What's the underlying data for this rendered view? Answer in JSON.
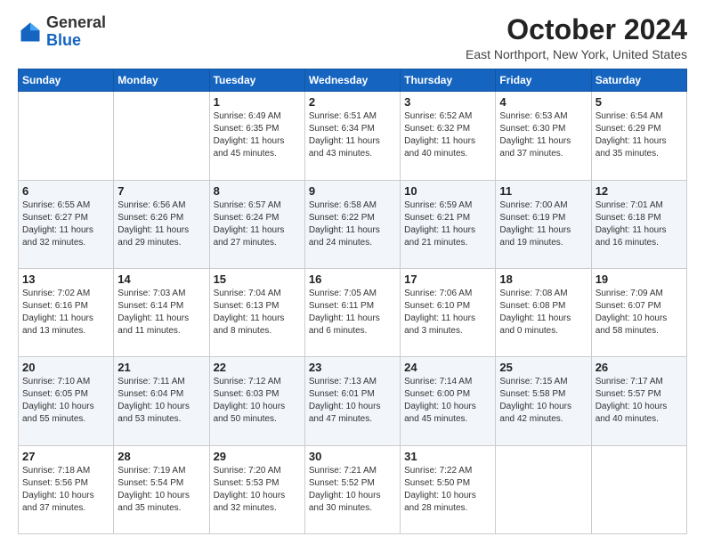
{
  "header": {
    "logo_general": "General",
    "logo_blue": "Blue",
    "month_title": "October 2024",
    "location": "East Northport, New York, United States"
  },
  "days_of_week": [
    "Sunday",
    "Monday",
    "Tuesday",
    "Wednesday",
    "Thursday",
    "Friday",
    "Saturday"
  ],
  "weeks": [
    [
      {
        "day": "",
        "info": ""
      },
      {
        "day": "",
        "info": ""
      },
      {
        "day": "1",
        "info": "Sunrise: 6:49 AM\nSunset: 6:35 PM\nDaylight: 11 hours and 45 minutes."
      },
      {
        "day": "2",
        "info": "Sunrise: 6:51 AM\nSunset: 6:34 PM\nDaylight: 11 hours and 43 minutes."
      },
      {
        "day": "3",
        "info": "Sunrise: 6:52 AM\nSunset: 6:32 PM\nDaylight: 11 hours and 40 minutes."
      },
      {
        "day": "4",
        "info": "Sunrise: 6:53 AM\nSunset: 6:30 PM\nDaylight: 11 hours and 37 minutes."
      },
      {
        "day": "5",
        "info": "Sunrise: 6:54 AM\nSunset: 6:29 PM\nDaylight: 11 hours and 35 minutes."
      }
    ],
    [
      {
        "day": "6",
        "info": "Sunrise: 6:55 AM\nSunset: 6:27 PM\nDaylight: 11 hours and 32 minutes."
      },
      {
        "day": "7",
        "info": "Sunrise: 6:56 AM\nSunset: 6:26 PM\nDaylight: 11 hours and 29 minutes."
      },
      {
        "day": "8",
        "info": "Sunrise: 6:57 AM\nSunset: 6:24 PM\nDaylight: 11 hours and 27 minutes."
      },
      {
        "day": "9",
        "info": "Sunrise: 6:58 AM\nSunset: 6:22 PM\nDaylight: 11 hours and 24 minutes."
      },
      {
        "day": "10",
        "info": "Sunrise: 6:59 AM\nSunset: 6:21 PM\nDaylight: 11 hours and 21 minutes."
      },
      {
        "day": "11",
        "info": "Sunrise: 7:00 AM\nSunset: 6:19 PM\nDaylight: 11 hours and 19 minutes."
      },
      {
        "day": "12",
        "info": "Sunrise: 7:01 AM\nSunset: 6:18 PM\nDaylight: 11 hours and 16 minutes."
      }
    ],
    [
      {
        "day": "13",
        "info": "Sunrise: 7:02 AM\nSunset: 6:16 PM\nDaylight: 11 hours and 13 minutes."
      },
      {
        "day": "14",
        "info": "Sunrise: 7:03 AM\nSunset: 6:14 PM\nDaylight: 11 hours and 11 minutes."
      },
      {
        "day": "15",
        "info": "Sunrise: 7:04 AM\nSunset: 6:13 PM\nDaylight: 11 hours and 8 minutes."
      },
      {
        "day": "16",
        "info": "Sunrise: 7:05 AM\nSunset: 6:11 PM\nDaylight: 11 hours and 6 minutes."
      },
      {
        "day": "17",
        "info": "Sunrise: 7:06 AM\nSunset: 6:10 PM\nDaylight: 11 hours and 3 minutes."
      },
      {
        "day": "18",
        "info": "Sunrise: 7:08 AM\nSunset: 6:08 PM\nDaylight: 11 hours and 0 minutes."
      },
      {
        "day": "19",
        "info": "Sunrise: 7:09 AM\nSunset: 6:07 PM\nDaylight: 10 hours and 58 minutes."
      }
    ],
    [
      {
        "day": "20",
        "info": "Sunrise: 7:10 AM\nSunset: 6:05 PM\nDaylight: 10 hours and 55 minutes."
      },
      {
        "day": "21",
        "info": "Sunrise: 7:11 AM\nSunset: 6:04 PM\nDaylight: 10 hours and 53 minutes."
      },
      {
        "day": "22",
        "info": "Sunrise: 7:12 AM\nSunset: 6:03 PM\nDaylight: 10 hours and 50 minutes."
      },
      {
        "day": "23",
        "info": "Sunrise: 7:13 AM\nSunset: 6:01 PM\nDaylight: 10 hours and 47 minutes."
      },
      {
        "day": "24",
        "info": "Sunrise: 7:14 AM\nSunset: 6:00 PM\nDaylight: 10 hours and 45 minutes."
      },
      {
        "day": "25",
        "info": "Sunrise: 7:15 AM\nSunset: 5:58 PM\nDaylight: 10 hours and 42 minutes."
      },
      {
        "day": "26",
        "info": "Sunrise: 7:17 AM\nSunset: 5:57 PM\nDaylight: 10 hours and 40 minutes."
      }
    ],
    [
      {
        "day": "27",
        "info": "Sunrise: 7:18 AM\nSunset: 5:56 PM\nDaylight: 10 hours and 37 minutes."
      },
      {
        "day": "28",
        "info": "Sunrise: 7:19 AM\nSunset: 5:54 PM\nDaylight: 10 hours and 35 minutes."
      },
      {
        "day": "29",
        "info": "Sunrise: 7:20 AM\nSunset: 5:53 PM\nDaylight: 10 hours and 32 minutes."
      },
      {
        "day": "30",
        "info": "Sunrise: 7:21 AM\nSunset: 5:52 PM\nDaylight: 10 hours and 30 minutes."
      },
      {
        "day": "31",
        "info": "Sunrise: 7:22 AM\nSunset: 5:50 PM\nDaylight: 10 hours and 28 minutes."
      },
      {
        "day": "",
        "info": ""
      },
      {
        "day": "",
        "info": ""
      }
    ]
  ]
}
